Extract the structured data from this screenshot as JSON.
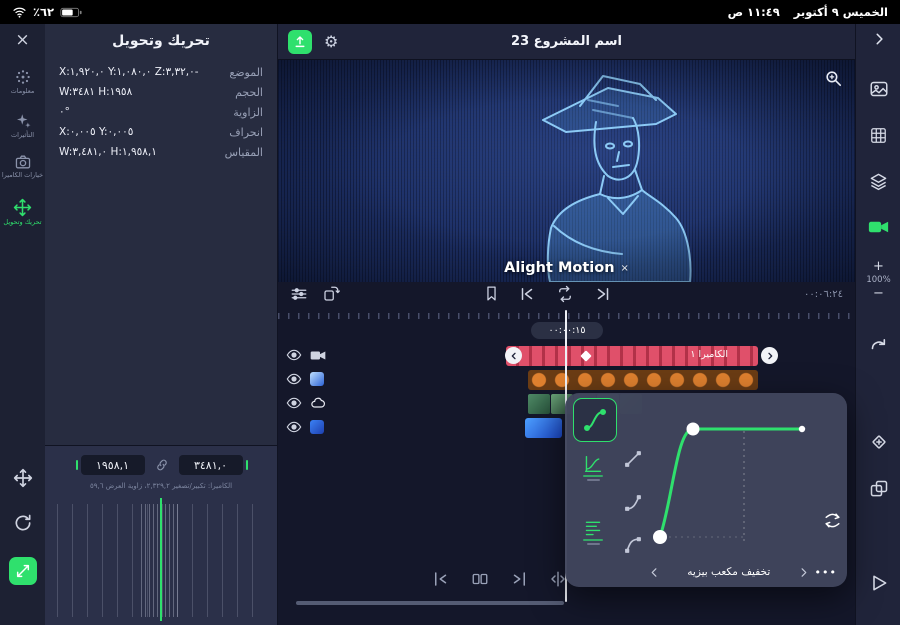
{
  "status_bar": {
    "battery": "٪٦٢",
    "date": "الخميس ٩ أكتوبر",
    "time": "١١:٤٩ ص"
  },
  "header": {
    "title": "اسم المشروع 23"
  },
  "left_rail": {
    "close": "×",
    "items": [
      {
        "label": "معلومات"
      },
      {
        "label": "التأثيرات"
      },
      {
        "label": "خيارات الكاميرا"
      },
      {
        "label": "تحريك وتحويل"
      }
    ]
  },
  "properties_panel": {
    "title": "تحريك وتحويل",
    "rows": [
      {
        "label": "الموضع",
        "value": "X:١,٩٢٠,٠ Y:١,٠٨٠,٠ Z:٣,٣٢,٠-"
      },
      {
        "label": "الحجم",
        "value": "W:٣٤٨١ H:١٩٥٨"
      },
      {
        "label": "الزاوية",
        "value": "٠°"
      },
      {
        "label": "انحراف",
        "value": "X:٠,٠٠٥ Y:٠,٠٠٥"
      },
      {
        "label": "المقياس",
        "value": "W:٣,٤٨١,٠ H:١,٩٥٨,١"
      }
    ]
  },
  "transform_footer": {
    "height_value": "١٩٥٨,١",
    "width_value": "٣٤٨١,٠",
    "camera_caption": "الكاميرا: تكبير/تصغير ٢,٣٢٩,٢، زاوية العرض ٥٩,٦"
  },
  "canvas": {
    "watermark": "Alight Motion",
    "watermark_close": "×"
  },
  "timeline": {
    "total_time": "٠٠:٠٦:٢٤",
    "playhead_time": "٠٠:٠٠:١٥",
    "tracks": [
      {
        "label": "الكاميرا ١"
      }
    ]
  },
  "zoom_control": {
    "plus": "+",
    "level": "100%",
    "minus": "−"
  },
  "easing_popup": {
    "title": "تخفيف مكعب بيزيه",
    "more": "•••"
  },
  "colors": {
    "accent_green": "#2fe06d",
    "track_red": "#e0506a",
    "track_orange": "#e0812f",
    "track_blue": "#3b82f6"
  }
}
